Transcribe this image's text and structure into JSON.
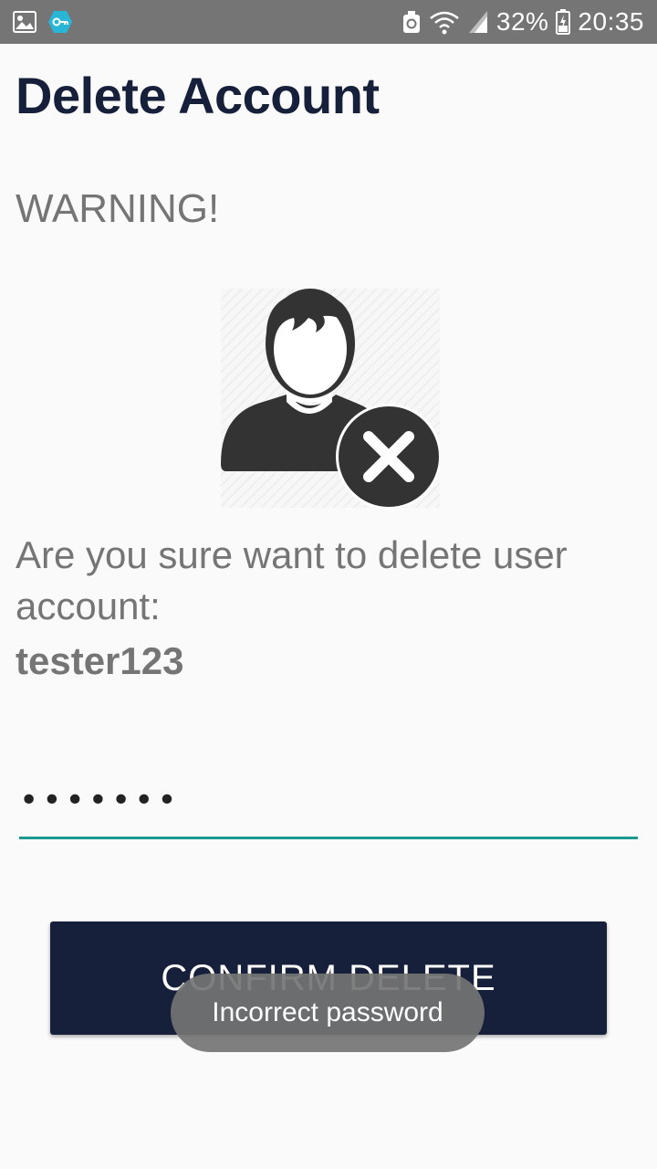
{
  "status_bar": {
    "left_icons": [
      "gallery-icon",
      "vpn-key-icon"
    ],
    "right_icons": [
      "alarm-sync-icon",
      "wifi-icon",
      "signal-icon",
      "battery-icon"
    ],
    "battery_percent": "32%",
    "time": "20:35"
  },
  "page": {
    "title": "Delete Account",
    "warning": "WARNING!",
    "question": "Are you sure want to delete user account:",
    "username": "tester123"
  },
  "password": {
    "value": "•••••••",
    "accent": "#1a9a8f"
  },
  "confirm_button": {
    "label": "CONFIRM DELETE",
    "color": "#17203a"
  },
  "toast": {
    "message": "Incorrect password"
  },
  "colors": {
    "title": "#17203a",
    "muted_text": "#757575",
    "status_bar": "#757575",
    "background": "#fafafa"
  }
}
